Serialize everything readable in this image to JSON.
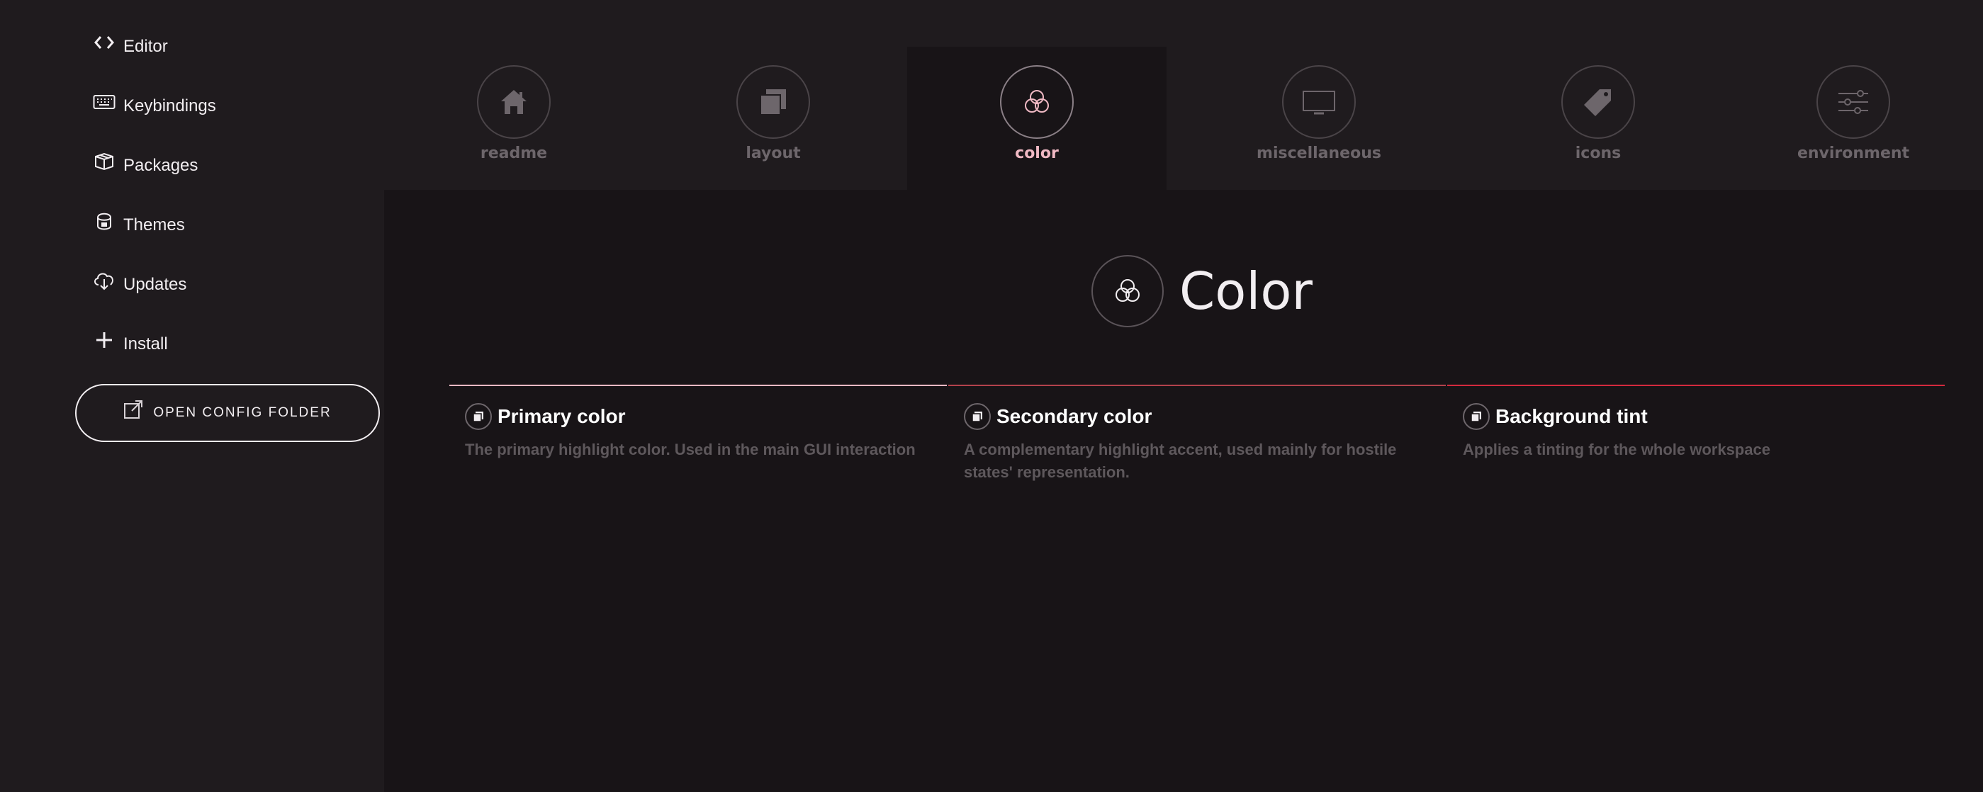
{
  "sidebar": {
    "items": [
      {
        "label": "Editor",
        "icon": "code-icon"
      },
      {
        "label": "Keybindings",
        "icon": "keyboard-icon"
      },
      {
        "label": "Packages",
        "icon": "package-icon"
      },
      {
        "label": "Themes",
        "icon": "paintcan-icon"
      },
      {
        "label": "Updates",
        "icon": "cloud-download-icon"
      },
      {
        "label": "Install",
        "icon": "plus-icon"
      }
    ],
    "config_button": "Open Config Folder"
  },
  "tabs": [
    {
      "label": "readme",
      "icon": "home-icon",
      "active": false
    },
    {
      "label": "layout",
      "icon": "layout-icon",
      "active": false
    },
    {
      "label": "color",
      "icon": "color-circles-icon",
      "active": true
    },
    {
      "label": "miscellaneous",
      "icon": "monitor-icon",
      "active": false
    },
    {
      "label": "icons",
      "icon": "tag-icon",
      "active": false
    },
    {
      "label": "environment",
      "icon": "sliders-icon",
      "active": false
    }
  ],
  "section": {
    "title": "Color",
    "icon": "color-circles-icon"
  },
  "cards": [
    {
      "title": "Primary color",
      "desc": "The primary highlight color. Used in the main GUI interaction",
      "accent": "#f0b9c4"
    },
    {
      "title": "Secondary color",
      "desc": "A complementary highlight accent, used mainly for hostile states' representation.",
      "accent": "#b3424c"
    },
    {
      "title": "Background tint",
      "desc": "Applies a tinting for the whole workspace",
      "accent": "#d42a3e"
    }
  ],
  "colors": {
    "background": "#1f1b1e",
    "panel": "#181417",
    "active_tab_label": "#f0b9c4"
  }
}
